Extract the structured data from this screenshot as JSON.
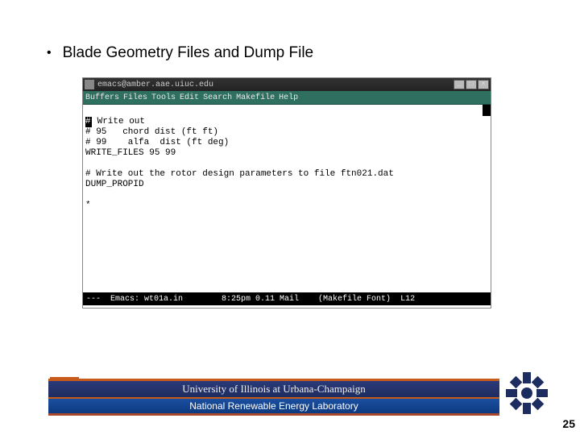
{
  "slide": {
    "bullet": "Blade Geometry Files and Dump File",
    "page_number": "25"
  },
  "emacs": {
    "title": "emacs@amber.aae.uiuc.edu",
    "menu": {
      "buffers": "Buffers",
      "files": "Files",
      "tools": "Tools",
      "edit": "Edit",
      "search": "Search",
      "makefile": "Makefile",
      "help": "Help"
    },
    "code": {
      "l1_after": " Write out",
      "l2": "# 95   chord dist (ft ft)",
      "l3": "# 99    alfa  dist (ft deg)",
      "l4": "WRITE_FILES 95 99",
      "l5": "",
      "l6": "# Write out the rotor design parameters to file ftn021.dat",
      "l7": "DUMP_PROPID",
      "l8": "",
      "l9": "*"
    },
    "status": "---  Emacs: wt01a.in        8:25pm 0.11 Mail    (Makefile Font)  L12"
  },
  "footer": {
    "uiuc": "University of Illinois at Urbana-Champaign",
    "nrel": "National Renewable Energy Laboratory",
    "ilogo": "I"
  }
}
